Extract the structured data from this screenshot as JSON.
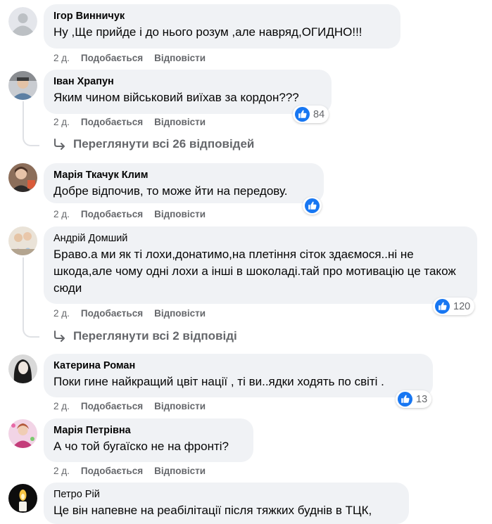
{
  "comments": [
    {
      "author": "Ігор Винничук",
      "text": "Ну ,Ще прийде і до нього розум ,але навряд,ОГИДНО!!!",
      "time": "2 д.",
      "like_label": "Подобається",
      "reply_label": "Відповісти"
    },
    {
      "author": "Іван Храпун",
      "text": "Яким чином військовий виїхав за кордон???",
      "time": "2 д.",
      "like_label": "Подобається",
      "reply_label": "Відповісти",
      "reactions": "84",
      "view_replies": "Переглянути всі 26 відповідей"
    },
    {
      "author": "Марія Ткачук Клим",
      "text": "Добре відпочив, то може йти на передову.",
      "time": "2 д.",
      "like_label": "Подобається",
      "reply_label": "Відповісти"
    },
    {
      "author": "Андрій Домший",
      "text": "Браво.а ми як ті лохи,донатимо,на плетіння сіток здаємося..ні не шкода,але чому одні лохи а інші в шоколаді.тай про мотивацію це також сюди",
      "time": "2 д.",
      "like_label": "Подобається",
      "reply_label": "Відповісти",
      "reactions": "120",
      "view_replies": "Переглянути всі 2 відповіді"
    },
    {
      "author": "Катерина Роман",
      "text": "Поки гине найкращий цвіт нації , ті ви..ядки ходять по світі .",
      "time": "2 д.",
      "like_label": "Подобається",
      "reply_label": "Відповісти",
      "reactions": "13"
    },
    {
      "author": "Марія Петрівна",
      "text": "А чо той бугаїско не на фронті?",
      "time": "2 д.",
      "like_label": "Подобається",
      "reply_label": "Відповісти"
    },
    {
      "author": "Петро Рій",
      "text": "Це він напевне на реабілітації після тяжких буднів в ТЦК,"
    }
  ],
  "colors": {
    "bubble": "#f0f2f5",
    "meta_text": "#65676b",
    "like_blue": "#1877f2"
  },
  "icons": {
    "like": "thumbs-up-icon",
    "reply_arrow": "reply-arrow-icon",
    "default_avatar": "default-avatar-icon"
  }
}
